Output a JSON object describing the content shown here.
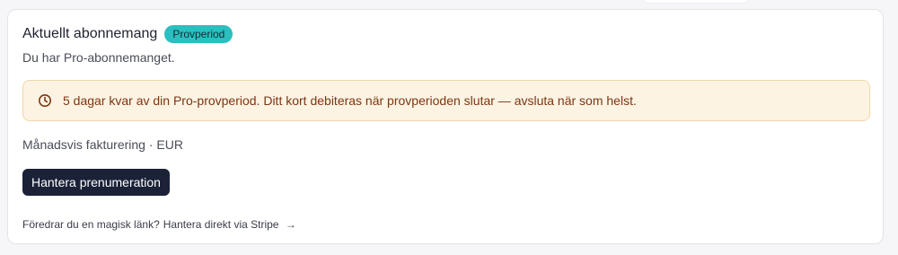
{
  "subscription": {
    "title": "Aktuellt abonnemang",
    "badge": "Provperiod",
    "description": "Du har Pro-abonnemanget.",
    "trial_notice": "5 dagar kvar av din Pro-provperiod. Ditt kort debiteras när provperioden slutar — avsluta när som helst.",
    "billing_info": "Månadsvis fakturering · EUR",
    "manage_button_label": "Hantera prenumeration",
    "magic_link_prompt": "Föredrar du en magisk länk?",
    "stripe_link_label": "Hantera direkt via Stripe",
    "arrow_glyph": "→"
  },
  "icons": {
    "trial_notice_icon": "clock-icon",
    "stripe_link_icon": "arrow-right-icon"
  },
  "colors": {
    "badge_bg": "#2bbfc0",
    "alert_bg": "#fdf3e3",
    "alert_text": "#7b3612",
    "button_bg": "#1b2238"
  }
}
